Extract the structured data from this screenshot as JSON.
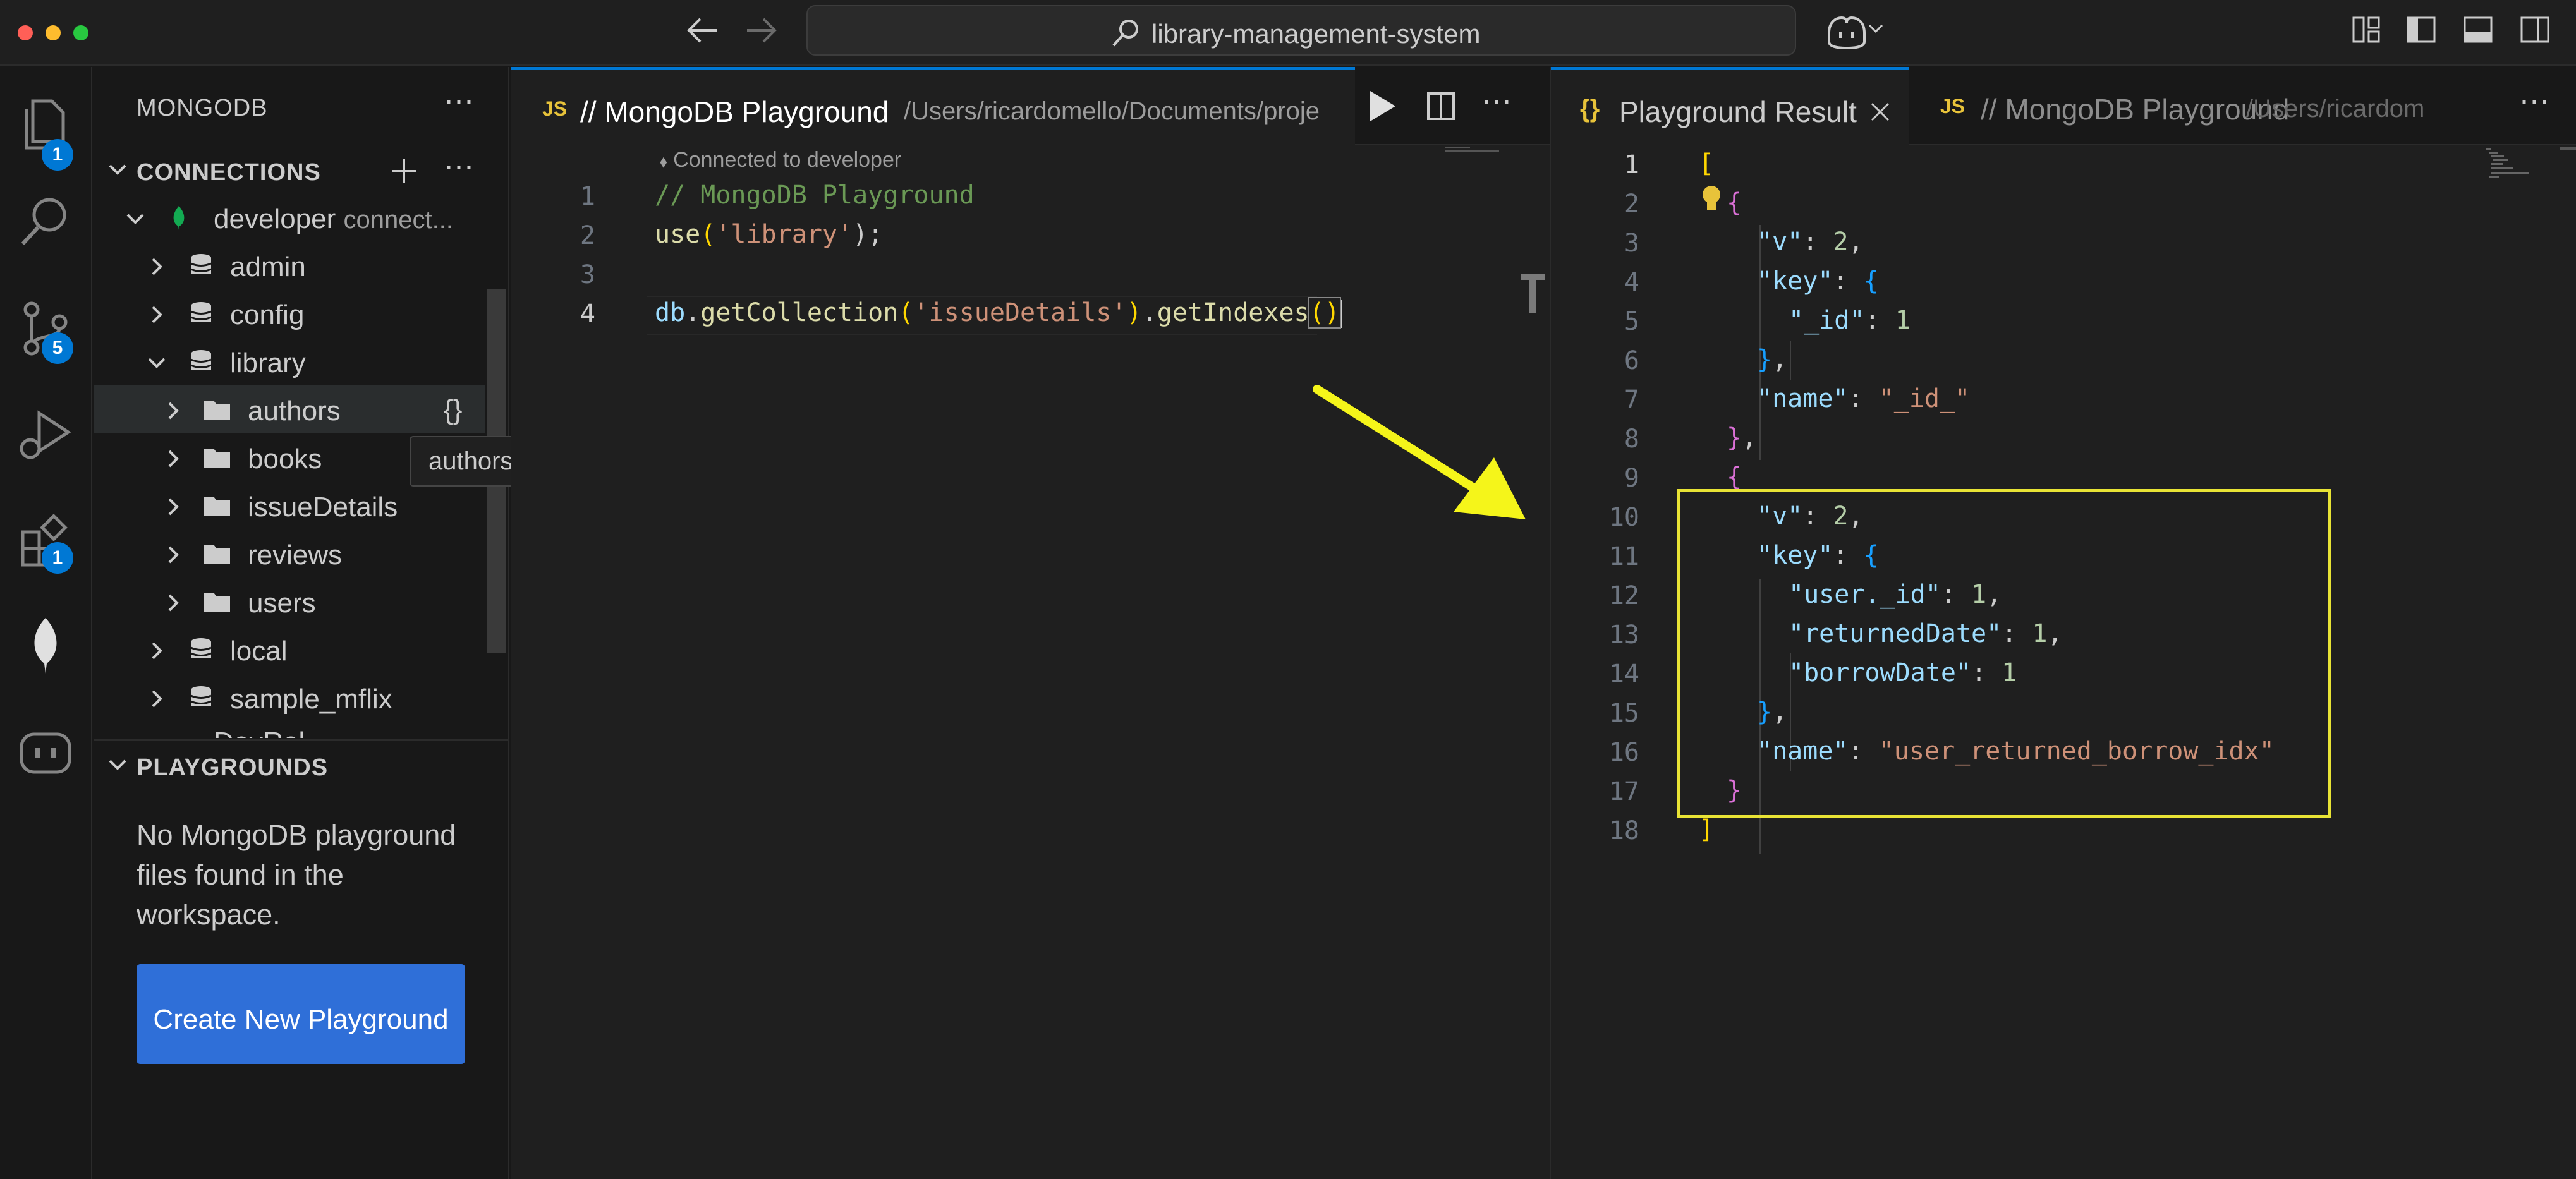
{
  "window": {
    "command_center": "library-management-system"
  },
  "activity_bar": {
    "explorer_badge": "1",
    "source_control_badge": "5",
    "extensions_badge": "1"
  },
  "sidebar": {
    "title": "MONGODB",
    "connections_label": "CONNECTIONS",
    "connection": {
      "name": "developer",
      "status": "connect..."
    },
    "databases": [
      {
        "name": "admin"
      },
      {
        "name": "config"
      },
      {
        "name": "library",
        "collections": [
          "authors",
          "books",
          "issueDetails",
          "reviews",
          "users"
        ]
      },
      {
        "name": "local"
      },
      {
        "name": "sample_mflix"
      }
    ],
    "partial_item": "DevRel...",
    "tooltip": "authors",
    "playgrounds_label": "PLAYGROUNDS",
    "no_playgrounds_text": "No MongoDB playground files found in the workspace.",
    "create_button": "Create New Playground"
  },
  "editor": {
    "tab": {
      "badge": "JS",
      "title": "// MongoDB Playground",
      "path": "/Users/ricardomello/Documents/proje"
    },
    "codelens": "Connected to developer",
    "line_numbers": [
      "1",
      "2",
      "3",
      "4"
    ],
    "lines": {
      "l1": "// MongoDB Playground",
      "l2_fn": "use",
      "l2_open": "(",
      "l2_str": "'library'",
      "l2_close": ");",
      "l4_obj": "db",
      "l4_dot1": ".",
      "l4_fn1": "getCollection",
      "l4_open": "(",
      "l4_str": "'issueDetails'",
      "l4_close": ")",
      "l4_dot2": ".",
      "l4_fn2": "getIndexes",
      "l4_parens": "()"
    }
  },
  "result": {
    "tab_icon": "{}",
    "tab_title": "Playground Result",
    "tab2_badge": "JS",
    "tab2_title": "// MongoDB Playground",
    "tab2_path": "/Users/ricardom",
    "line_numbers": [
      "1",
      "2",
      "3",
      "4",
      "5",
      "6",
      "7",
      "8",
      "9",
      "10",
      "11",
      "12",
      "13",
      "14",
      "15",
      "16",
      "17",
      "18"
    ],
    "json": {
      "v_key": "\"v\"",
      "v_val": "2",
      "key_key": "\"key\"",
      "id_key": "\"_id\"",
      "id_val": "1",
      "name_key": "\"name\"",
      "name1_val": "\"_id_\"",
      "user_id_key": "\"user._id\"",
      "user_id_val": "1",
      "returned_key": "\"returnedDate\"",
      "returned_val": "1",
      "borrow_key": "\"borrowDate\"",
      "borrow_val": "1",
      "name2_val": "\"user_returned_borrow_idx\""
    }
  },
  "annotation": {
    "arrow_color": "#f5f51a",
    "box_color": "#e8e335"
  }
}
